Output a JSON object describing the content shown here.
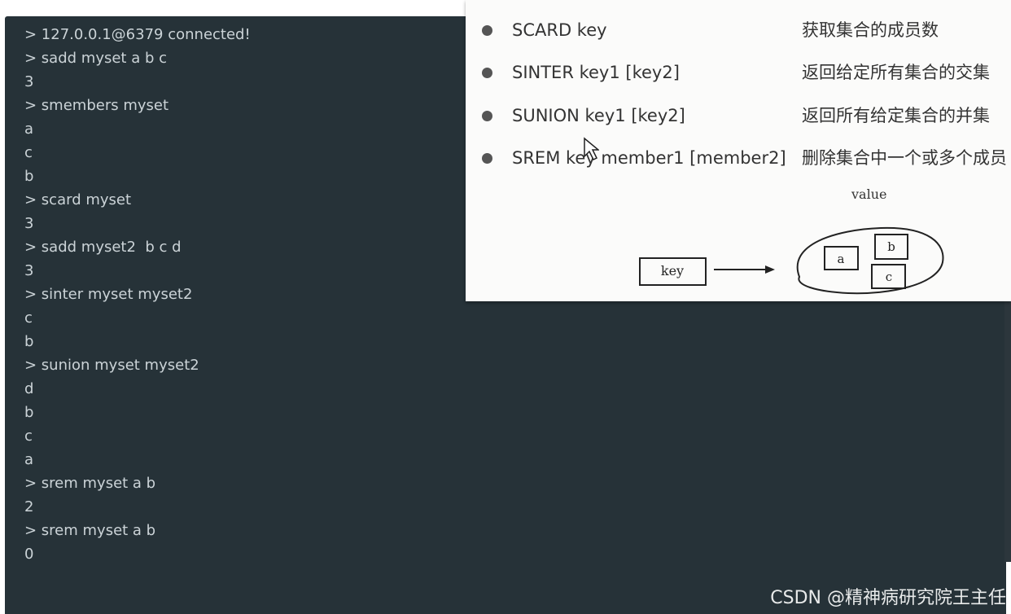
{
  "terminal": {
    "lines": [
      "> 127.0.0.1@6379 connected!",
      "> sadd myset a b c",
      "3",
      "> smembers myset",
      "a",
      "c",
      "b",
      "> scard myset",
      "3",
      "> sadd myset2  b c d",
      "3",
      "> sinter myset myset2",
      "c",
      "b",
      "> sunion myset myset2",
      "d",
      "b",
      "c",
      "a",
      "> srem myset a b",
      "2",
      "> srem myset a b",
      "0"
    ]
  },
  "slide": {
    "commands": [
      {
        "syntax": "SCARD key",
        "desc": "获取集合的成员数"
      },
      {
        "syntax": "SINTER key1 [key2]",
        "desc": "返回给定所有集合的交集"
      },
      {
        "syntax": "SUNION key1 [key2]",
        "desc": "返回所有给定集合的并集"
      },
      {
        "syntax": "SREM key member1 [member2]",
        "desc": "删除集合中一个或多个成员"
      }
    ],
    "diagram": {
      "key_label": "key",
      "value_label": "value",
      "members": [
        "a",
        "b",
        "c"
      ]
    }
  },
  "watermark": "CSDN @精神病研究院王主任",
  "colors": {
    "terminal_bg": "#263238",
    "terminal_text": "#cbd3d7",
    "slide_bg": "#fbfbfa"
  }
}
